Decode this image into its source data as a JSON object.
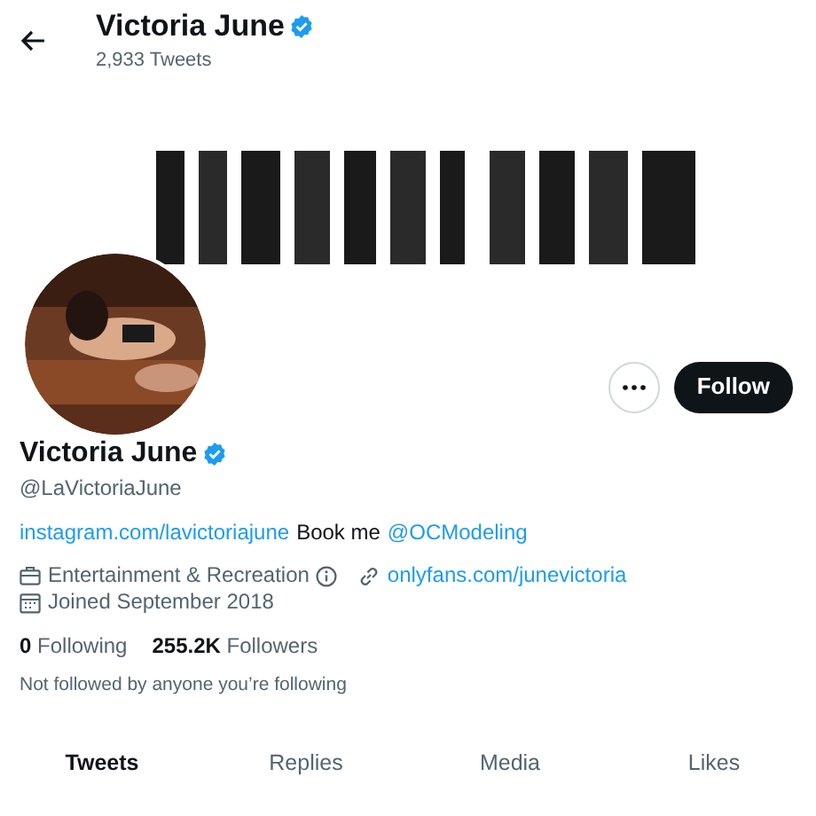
{
  "header": {
    "name": "Victoria June",
    "verified": true,
    "tweet_count": "2,933 Tweets"
  },
  "actions": {
    "follow": "Follow"
  },
  "profile": {
    "name": "Victoria June",
    "verified": true,
    "handle": "@LaVictoriaJune",
    "bio": [
      {
        "kind": "link",
        "text": "instagram.com/lavictoriajune"
      },
      {
        "kind": "text",
        "text": "Book me"
      },
      {
        "kind": "link",
        "text": "@OCModeling"
      }
    ],
    "category": "Entertainment & Recreation",
    "website": "onlyfans.com/junevictoria",
    "joined": "Joined September 2018",
    "following_count": "0",
    "following_label": "Following",
    "followers_count": "255.2K",
    "followers_label": "Followers",
    "followed_by": "Not followed by anyone you’re following"
  },
  "tabs": [
    {
      "label": "Tweets",
      "selected": true
    },
    {
      "label": "Replies",
      "selected": false
    },
    {
      "label": "Media",
      "selected": false
    },
    {
      "label": "Likes",
      "selected": false
    }
  ]
}
